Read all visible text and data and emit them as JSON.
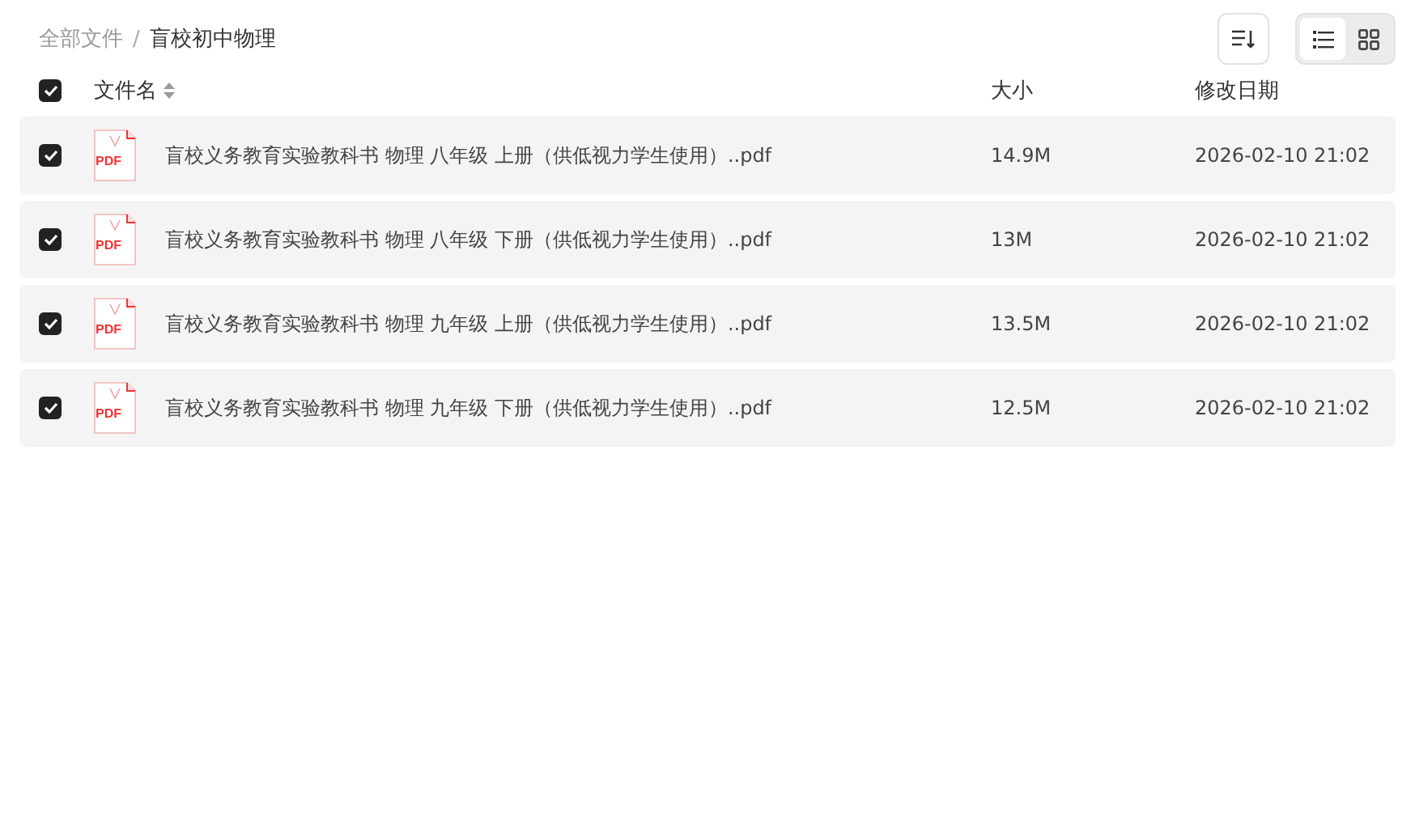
{
  "breadcrumb": [
    {
      "label": "全部文件",
      "current": false
    },
    {
      "label": "/",
      "kind": "separator"
    },
    {
      "label": "盲校初中物理",
      "current": true
    }
  ],
  "toolbar": {
    "view_toggle": [
      {
        "kind": "list",
        "selected": true
      },
      {
        "kind": "grid",
        "selected": false
      }
    ]
  },
  "table": {
    "select_all": {
      "checked": true
    },
    "columns": [
      {
        "label": "文件名",
        "sortable": true
      },
      {
        "label": "大小",
        "sortable": false
      },
      {
        "label": "修改日期",
        "sortable": false
      }
    ],
    "rows": [
      {
        "checked": true,
        "file_badge": "PDF",
        "name": "盲校义务教育实验教科书 物理 八年级 上册（供低视力学生使用）..pdf",
        "size": "14.9M",
        "modified": "2026-02-10 21:02"
      },
      {
        "checked": true,
        "file_badge": "PDF",
        "name": "盲校义务教育实验教科书 物理 八年级 下册（供低视力学生使用）..pdf",
        "size": "13M",
        "modified": "2026-02-10 21:02"
      },
      {
        "checked": true,
        "file_badge": "PDF",
        "name": "盲校义务教育实验教科书 物理 九年级 上册（供低视力学生使用）..pdf",
        "size": "13.5M",
        "modified": "2026-02-10 21:02"
      },
      {
        "checked": true,
        "file_badge": "PDF",
        "name": "盲校义务教育实验教科书 物理 九年级 下册（供低视力学生使用）..pdf",
        "size": "12.5M",
        "modified": "2026-02-10 21:02"
      }
    ]
  }
}
